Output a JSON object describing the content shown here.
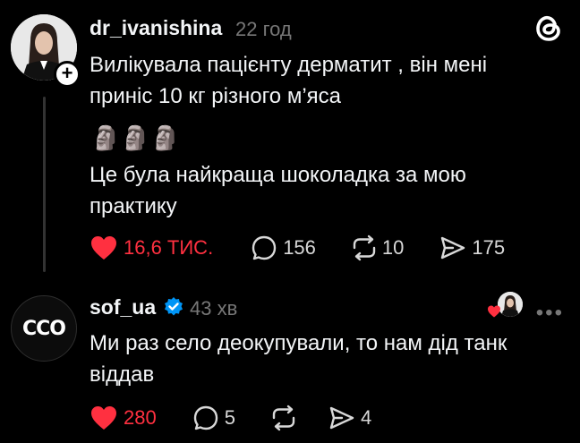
{
  "posts": [
    {
      "username": "dr_ivanishina",
      "time": "22 год",
      "text_1": "Вилікувала пацієнту дерматит , він мені приніс 10 кг різного м’яса",
      "emoji": "🗿🗿🗿",
      "text_2": "Це була найкраща шоколадка за мою практику",
      "likes": "16,6 ТИС.",
      "comments": "156",
      "reposts": "10",
      "shares": "175"
    },
    {
      "username": "sof_ua",
      "avatar_text": "ССО",
      "time": "43 хв",
      "text": "Ми раз село деокупували, то нам дід танк віддав",
      "likes": "280",
      "comments": "5",
      "reposts": "",
      "shares": "4"
    }
  ],
  "icons": [
    "threads-logo-icon",
    "plus-icon",
    "heart-icon",
    "comment-icon",
    "repost-icon",
    "share-icon",
    "verified-icon",
    "more-icon"
  ],
  "colors": {
    "background": "#000000",
    "text": "#f3f5f7",
    "muted": "#777777",
    "like": "#ff3040",
    "verified": "#0095f6"
  }
}
